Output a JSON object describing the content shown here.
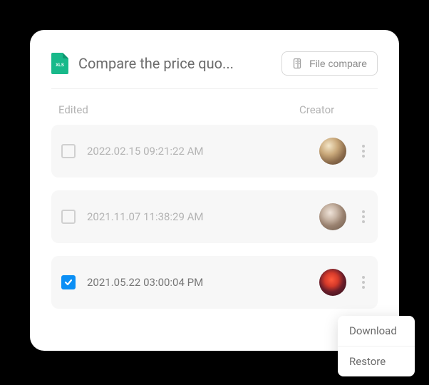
{
  "header": {
    "file_type": "XLS",
    "title": "Compare the price quo...",
    "compare_label": "File compare"
  },
  "columns": {
    "edited": "Edited",
    "creator": "Creator"
  },
  "rows": [
    {
      "timestamp": "2022.02.15 09:21:22 AM",
      "checked": false
    },
    {
      "timestamp": "2021.11.07 11:38:29 AM",
      "checked": false
    },
    {
      "timestamp": "2021.05.22  03:00:04 PM",
      "checked": true
    }
  ],
  "menu": {
    "download": "Download",
    "restore": "Restore"
  }
}
